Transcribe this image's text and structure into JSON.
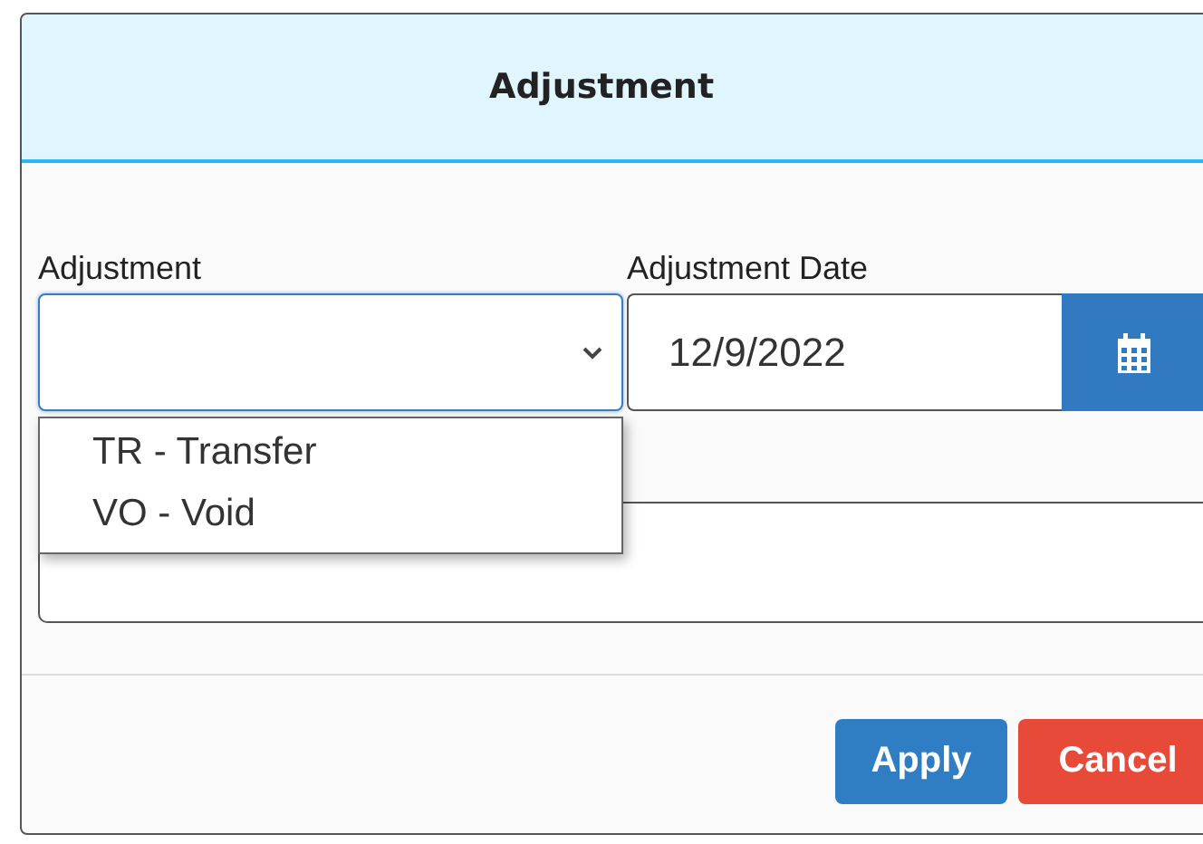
{
  "dialog": {
    "title": "Adjustment"
  },
  "fields": {
    "adjustment": {
      "label": "Adjustment",
      "expanded": true,
      "options": [
        {
          "label": "TR - Transfer",
          "selected": false
        },
        {
          "label": "VO - Void",
          "selected": false
        }
      ]
    },
    "date": {
      "label": "Adjustment Date",
      "value": "12/9/2022"
    }
  },
  "buttons": [
    {
      "label": "Apply",
      "kind": "primary"
    },
    {
      "label": "Cancel",
      "kind": "danger"
    }
  ]
}
